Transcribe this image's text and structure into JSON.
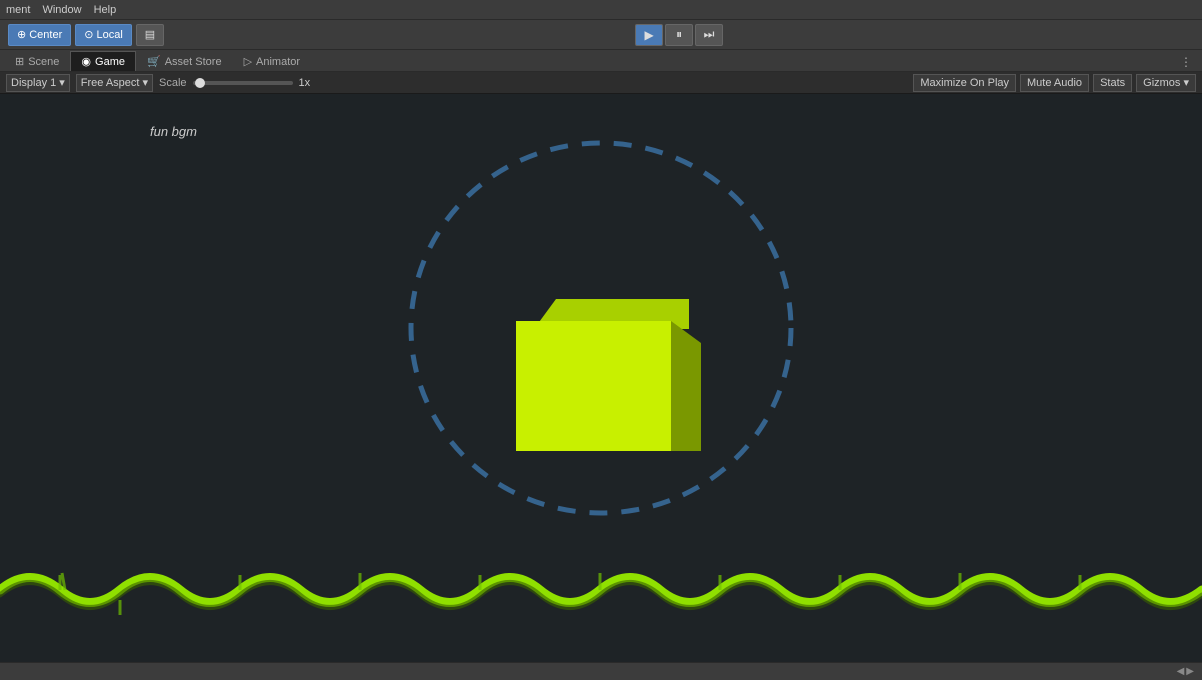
{
  "menu": {
    "items": [
      "ment",
      "Window",
      "Help"
    ]
  },
  "toolbar": {
    "left": [
      {
        "label": "Center",
        "icon": "⊕",
        "active": true
      },
      {
        "label": "Local",
        "icon": "⊙",
        "active": true
      },
      {
        "label": "layers",
        "icon": "▤",
        "active": false
      }
    ],
    "play_buttons": [
      {
        "icon": "▶",
        "title": "Play",
        "active": true
      },
      {
        "icon": "⏸",
        "title": "Pause",
        "active": false
      },
      {
        "icon": "⏭",
        "title": "Step",
        "active": false
      }
    ],
    "right": []
  },
  "tabs": [
    {
      "label": "Scene",
      "icon": "grid",
      "active": false
    },
    {
      "label": "Game",
      "icon": "camera",
      "active": true
    },
    {
      "label": "Asset Store",
      "icon": "store",
      "active": false
    },
    {
      "label": "Animator",
      "icon": "animator",
      "active": false
    }
  ],
  "game_toolbar": {
    "display_label": "Display 1",
    "aspect_label": "Free Aspect",
    "scale_label": "Scale",
    "scale_value": "1x",
    "right_buttons": [
      "Maximize On Play",
      "Mute Audio",
      "Stats",
      "Gizmos ▾"
    ]
  },
  "viewport": {
    "bgm_label": "fun bgm",
    "background_color": "#1e2326"
  },
  "status_bar": {
    "text": ""
  }
}
